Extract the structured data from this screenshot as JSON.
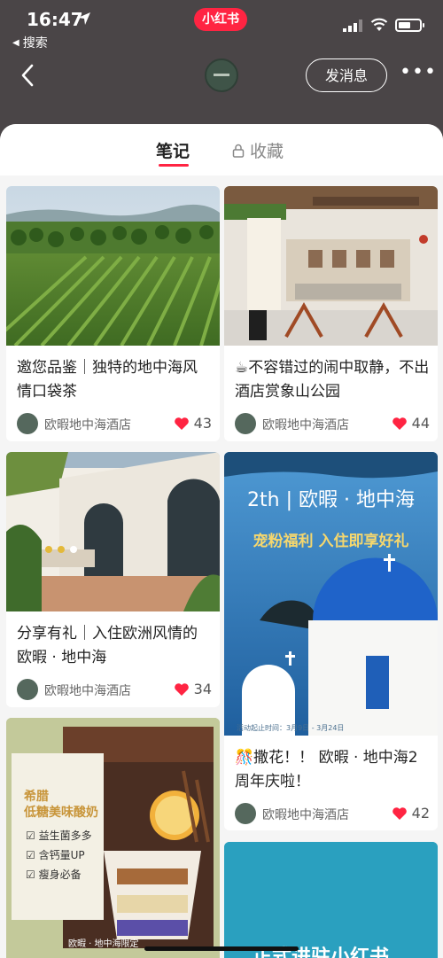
{
  "status": {
    "time": "16:47",
    "back_app": "搜索",
    "brand": "小红书"
  },
  "nav": {
    "message_button": "发消息",
    "more": "•••"
  },
  "tabs": {
    "notes": "笔记",
    "favorites": "收藏"
  },
  "posts": [
    {
      "title": "邀您品鉴｜独特的地中海风情口袋茶",
      "author": "欧暇地中海酒店",
      "likes": "43"
    },
    {
      "title": "☕不容错过的闹中取静，不出酒店赏象山公园",
      "author": "欧暇地中海酒店",
      "likes": "44"
    },
    {
      "title": "分享有礼｜入住欧洲风情的欧暇 · 地中海",
      "author": "欧暇地中海酒店",
      "likes": "34"
    },
    {
      "title": "🎊撒花！！ 欧暇 · 地中海2周年庆啦！",
      "author": "欧暇地中海酒店",
      "likes": "42",
      "cover_text": {
        "headline": "2th | 欧暇 · 地中海",
        "tagline": "宠粉福利 入住即享好礼",
        "footnote": "活动起止时间：3月9日 - 3月24日"
      }
    },
    {
      "cover_text": {
        "heading1": "希腊",
        "heading2": "低糖美味酸奶",
        "points": [
          "益生菌多多",
          "含钙量UP",
          "瘦身必备"
        ],
        "footer": "欧暇 · 地中海限定"
      }
    },
    {
      "cover_text": {
        "headline": "正式进驻小红书"
      }
    }
  ],
  "colors": {
    "accent": "#ff2442",
    "header_bg": "#4a4547",
    "avatar": "#55685d"
  }
}
